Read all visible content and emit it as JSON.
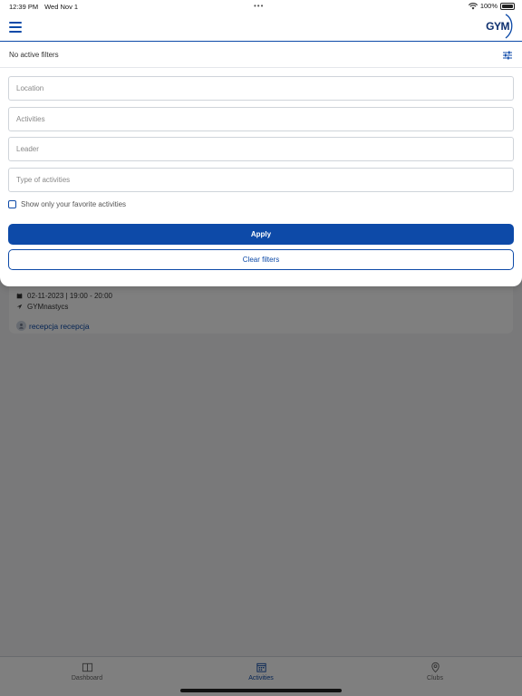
{
  "status_bar": {
    "time": "12:39 PM",
    "date": "Wed Nov 1",
    "battery": "100%",
    "icons": [
      "wifi-icon",
      "battery-icon"
    ]
  },
  "header": {
    "menu_icon": "hamburger-menu-icon",
    "logo_text": "GYM"
  },
  "filters": {
    "status": "No active filters",
    "settings_icon": "sliders-icon",
    "location_placeholder": "Location",
    "activities_placeholder": "Activities",
    "leader_placeholder": "Leader",
    "type_placeholder": "Type of activities",
    "favorites_label": "Show only your favorite activities",
    "favorites_checked": false,
    "apply_label": "Apply",
    "clear_label": "Clear filters"
  },
  "activity": {
    "datetime": "02-11-2023 | 19:00 - 20:00",
    "club": "GYMnastycs",
    "leader": "recepcja recepcja",
    "icons": [
      "calendar-icon",
      "location-arrow-icon",
      "person-icon"
    ]
  },
  "tabs": [
    {
      "label": "Dashboard",
      "icon": "book-icon",
      "active": false
    },
    {
      "label": "Activities",
      "icon": "calendar-icon",
      "active": true
    },
    {
      "label": "Clubs",
      "icon": "map-pin-icon",
      "active": false
    }
  ],
  "colors": {
    "accent": "#0d4aa8",
    "overlay": "#7b7b7b"
  }
}
